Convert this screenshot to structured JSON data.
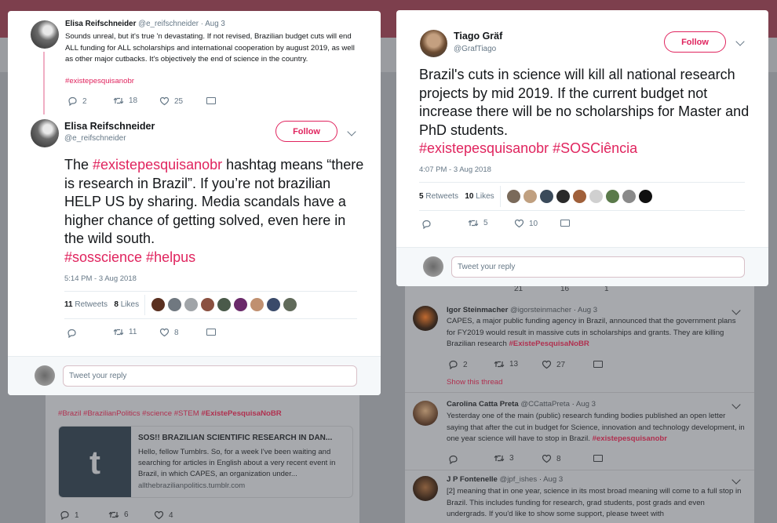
{
  "colors": {
    "accent": "#e0245e",
    "muted": "#657786"
  },
  "left": {
    "parent": {
      "name": "Elisa Reifschneider",
      "handle": "@e_reifschneider",
      "time": "Aug 3",
      "text": "Sounds unreal, but it's true 'n devastating. If not revised, Brazilian budget cuts will end ALL funding for ALL scholarships and international cooperation by august 2019, as well as other major cutbacks. It's objectively the end of science in the country.",
      "hashtag": "#existepesquisanobr",
      "replies": "2",
      "retweets": "18",
      "likes": "25"
    },
    "main": {
      "name": "Elisa Reifschneider",
      "handle": "@e_reifschneider",
      "follow": "Follow",
      "text_1": "The ",
      "tag_1": "#existepesquisanobr",
      "text_2": " hashtag means “there is research in Brazil”. If you’re not brazilian HELP US by sharing. Media scandals have a higher chance of getting solved, even here in the wild south.",
      "tags_end": "#sosscience #helpus",
      "timestamp": "5:14 PM - 3 Aug 2018",
      "retweets_count": "11",
      "retweets_label": "Retweets",
      "likes_count": "8",
      "likes_label": "Likes",
      "act_retweets": "11",
      "act_likes": "8"
    },
    "reply_placeholder": "Tweet your reply"
  },
  "right": {
    "name": "Tiago Gräf",
    "handle": "@GrafTiago",
    "follow": "Follow",
    "text": "Brazil's cuts in science will kill all national research projects by mid 2019. If the current budget not increase there will be no scholarships for Master and PhD students.",
    "tags": "#existepesquisanobr #SOSCiência",
    "timestamp": "4:07 PM - 3 Aug 2018",
    "retweets_count": "5",
    "retweets_label": "Retweets",
    "likes_count": "10",
    "likes_label": "Likes",
    "act_retweets": "5",
    "act_likes": "10",
    "reply_placeholder": "Tweet your reply"
  },
  "bg_right": {
    "partial_counts": {
      "replies": "21",
      "retweets": "16",
      "likes": "1"
    },
    "t1": {
      "name": "Igor Steinmacher",
      "handle": "@igorsteinmacher",
      "time": "Aug 3",
      "text": "CAPES, a major public funding agency in Brazil, announced that the government plans for FY2019 would result in massive cuts in scholarships and grants. They are killing Brazilian research",
      "tag": "#ExistePesquisaNoBR",
      "replies": "2",
      "retweets": "13",
      "likes": "27",
      "show_thread": "Show this thread"
    },
    "t2": {
      "name": "Carolina Catta Preta",
      "handle": "@CCattaPreta",
      "time": "Aug 3",
      "text": "Yesterday one of the main (public) research funding bodies published an open letter saying that after the cut in budget for Science, innovation and technology development, in one year science will have to stop in Brazil.",
      "tag": "#existepesquisanobr",
      "retweets": "3",
      "likes": "8"
    },
    "t3": {
      "name": "J P Fontenelle",
      "handle": "@jpf_ishes",
      "time": "Aug 3",
      "text": "[2] meaning that in one year, science in its most broad meaning will come to a full stop in Brazil. This includes funding for research, grad students, post grads and even undergrads. If you'd like to show some support, please tweet with"
    }
  },
  "bg_left": {
    "tags": "#Brazil #BrazilianPolitics #science #STEM",
    "tag_bold": "#ExistePesquisaNoBR",
    "card_title": "SOS!! BRAZILIAN SCIENTIFIC RESEARCH IN DAN...",
    "card_text": "Hello, fellow Tumblrs. So, for a week I've been waiting and searching for articles in English about a very recent event in Brazil, in which CAPES, an organization under...",
    "card_url": "allthebrazilianpolitics.tumblr.com",
    "card_logo": "t",
    "replies": "1",
    "retweets": "6",
    "likes": "4"
  }
}
